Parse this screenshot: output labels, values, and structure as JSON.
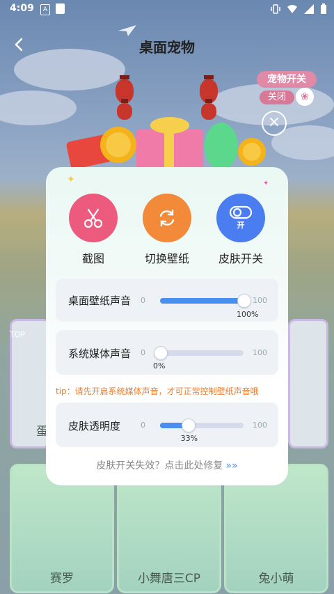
{
  "status_bar": {
    "time": "4:09",
    "notif_letter": "A"
  },
  "header": {
    "title": "桌面宠物"
  },
  "pet_toggle": {
    "label": "宠物开关",
    "state": "关闭"
  },
  "popup": {
    "functions": [
      {
        "label": "截图",
        "icon": "scissors-icon",
        "color": "#ec5a7e"
      },
      {
        "label": "切换壁纸",
        "icon": "switch-icon",
        "color": "#f28a3a"
      },
      {
        "label": "皮肤开关",
        "icon": "toggle-icon",
        "color": "#4a7ef0",
        "badge": "开"
      }
    ],
    "sliders": [
      {
        "label": "桌面壁纸声音",
        "min": "0",
        "max": "100",
        "value": 100,
        "value_text": "100%"
      },
      {
        "label": "系统媒体声音",
        "min": "0",
        "max": "100",
        "value": 0,
        "value_text": "0%"
      },
      {
        "label": "皮肤透明度",
        "min": "0",
        "max": "100",
        "value": 33,
        "value_text": "33%"
      }
    ],
    "tip": "tip：请先开启系统媒体声音，才可正常控制壁纸声音哦",
    "repair": "皮肤开关失效？点击此处修复",
    "repair_arrows": "»»"
  },
  "background_cards": [
    {
      "label": "赛罗"
    },
    {
      "label": "小舞唐三CP"
    },
    {
      "label": "兔小萌"
    }
  ],
  "side_labels": {
    "left_tag": "TOP",
    "left_char": "蛋"
  }
}
